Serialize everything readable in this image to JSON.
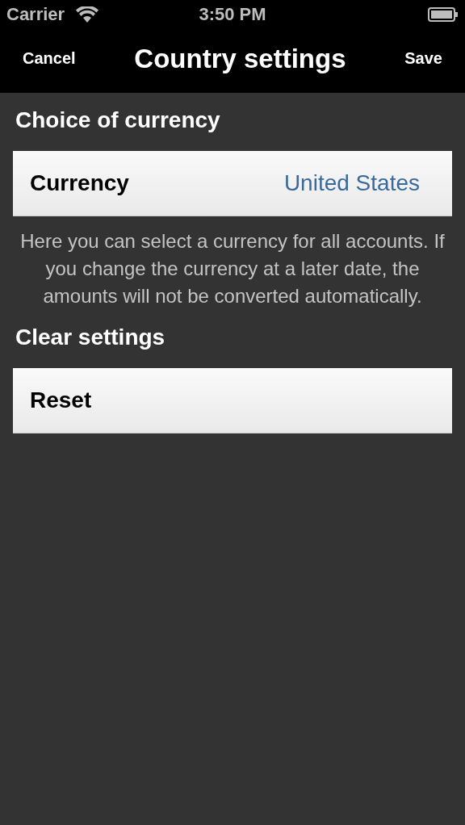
{
  "status_bar": {
    "carrier": "Carrier",
    "time": "3:50 PM"
  },
  "nav_bar": {
    "left_button": "Cancel",
    "title": "Country settings",
    "right_button": "Save"
  },
  "sections": [
    {
      "header": "Choice of currency",
      "rows": [
        {
          "label": "Currency",
          "value": "United States"
        }
      ],
      "footer": "Here you can select a currency for all accounts. If you change the currency at a later date, the amounts will not be converted automatically."
    },
    {
      "header": "Clear settings",
      "rows": [
        {
          "label": "Reset"
        }
      ]
    }
  ]
}
